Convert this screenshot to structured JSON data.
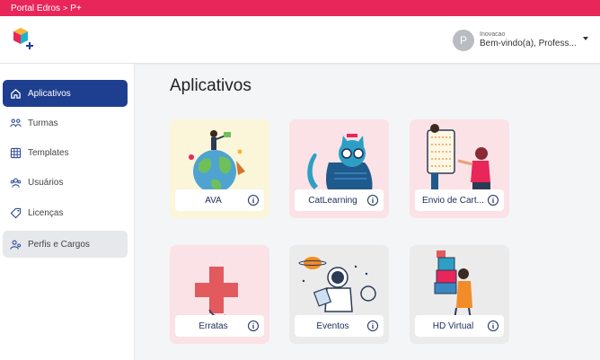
{
  "topbar": {
    "crumb1": "Portal Edros",
    "separator": ">",
    "crumb2": "P+"
  },
  "header": {
    "user": {
      "initial": "P",
      "org": "Inovacao",
      "name": "Bem-vindo(a), Profess..."
    }
  },
  "sidebar": {
    "items": [
      {
        "label": "Aplicativos",
        "icon": "home-icon"
      },
      {
        "label": "Turmas",
        "icon": "users-group-icon"
      },
      {
        "label": "Templates",
        "icon": "grid-icon"
      },
      {
        "label": "Usuários",
        "icon": "users-icon"
      },
      {
        "label": "Licenças",
        "icon": "tag-icon"
      },
      {
        "label": "Perfis e Cargos",
        "icon": "user-role-icon"
      }
    ]
  },
  "main": {
    "title": "Aplicativos",
    "apps": [
      {
        "label": "AVA",
        "bg": "#fbf5d9"
      },
      {
        "label": "CatLearning",
        "bg": "#fbe2e6"
      },
      {
        "label": "Envio de Cart...",
        "bg": "#fbe2e6"
      },
      {
        "label": "Erratas",
        "bg": "#fbe2e6"
      },
      {
        "label": "Eventos",
        "bg": "#ebebeb"
      },
      {
        "label": "HD Virtual",
        "bg": "#ebebeb"
      }
    ],
    "info_glyph": "i"
  },
  "colors": {
    "topbar": "#e8265a",
    "active_nav": "#1e3f8f"
  }
}
